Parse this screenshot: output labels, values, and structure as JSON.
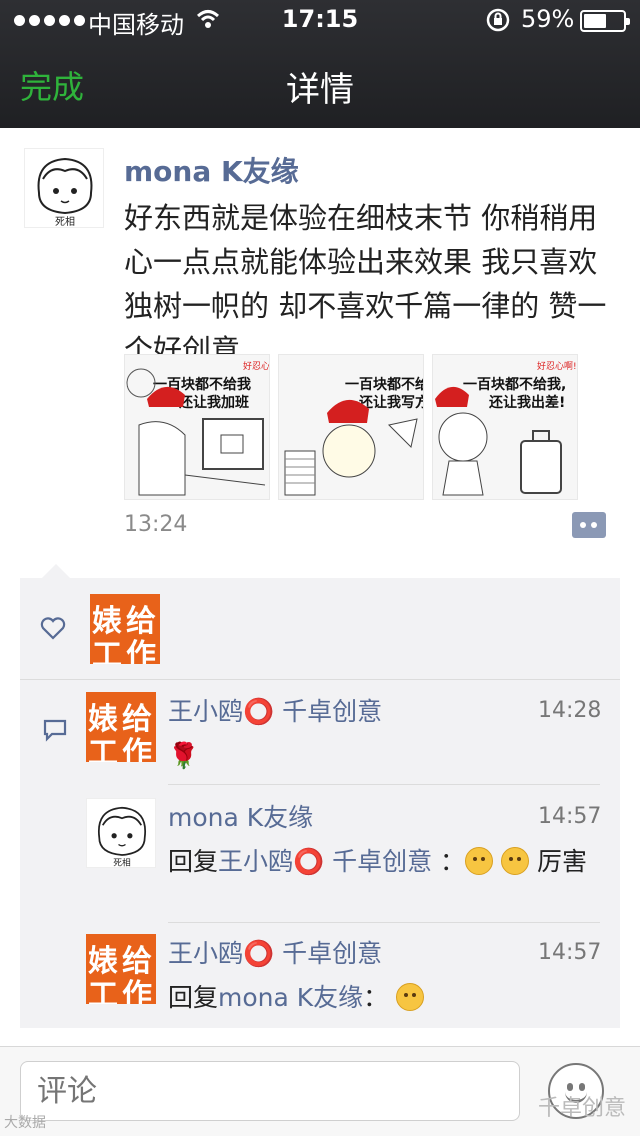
{
  "status": {
    "carrier": "中国移动",
    "time": "17:15",
    "battery": "59%",
    "battery_level": 0.59
  },
  "nav": {
    "done": "完成",
    "title": "详情"
  },
  "post": {
    "author": "mona K友缘",
    "avatar_caption": "死相",
    "text": "好东西就是体验在细枝末节 你稍稍用心一点点就能体验出来效果 我只喜欢独树一帜的 却不喜欢千篇一律的 赞一个好创意",
    "time": "13:24",
    "photos": [
      {
        "top_tag": "好忍心",
        "line1": "一百块都不给我",
        "line2": "还让我加班"
      },
      {
        "top_tag": "",
        "line1": "一百块都不给",
        "line2": "还让我写方"
      },
      {
        "top_tag": "好忍心啊!",
        "line1": "一百块都不给我,",
        "line2": "还让我出差!"
      }
    ]
  },
  "avatar_k": {
    "c1": "婊",
    "c2": "给",
    "c3": "工",
    "c4": "作"
  },
  "comments": [
    {
      "name": "王小鸥⭕ 千卓创意",
      "time": "14:28",
      "text": "🌹",
      "reply_prefix": "",
      "reply_to": "",
      "suffix": ""
    },
    {
      "name": "mona K友缘",
      "time": "14:57",
      "reply_prefix": "回复",
      "reply_to": "王小鸥⭕ 千卓创意",
      "suffix": "：",
      "tail": "厉害"
    },
    {
      "name": "王小鸥⭕ 千卓创意",
      "time": "14:57",
      "reply_prefix": "回复",
      "reply_to": "mona K友缘",
      "suffix": "："
    }
  ],
  "input": {
    "placeholder": "评论"
  },
  "watermark": {
    "left": "大数据",
    "right": "千卓创意"
  },
  "colors": {
    "accent_green": "#2fb33b",
    "link_blue": "#576b95",
    "avatar_orange": "#e8621a"
  }
}
